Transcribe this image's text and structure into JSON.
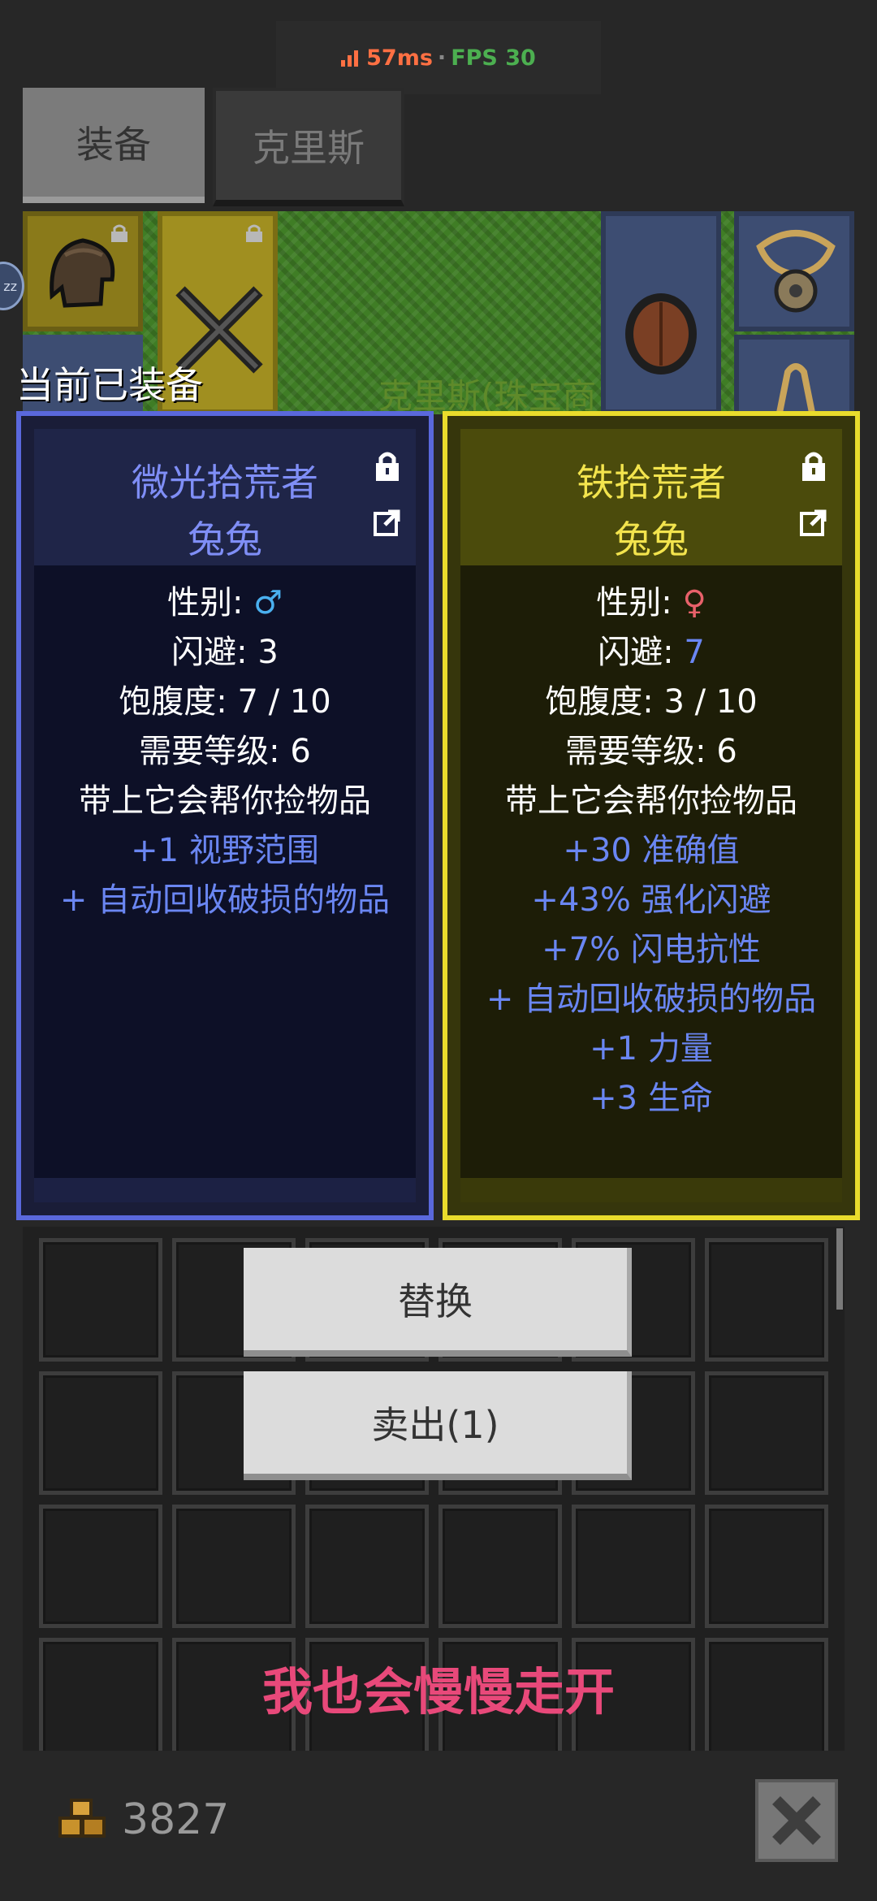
{
  "status": {
    "ping": "57ms",
    "separator": "·",
    "fps": "FPS 30"
  },
  "tabs": [
    {
      "label": "装备",
      "active": true
    },
    {
      "label": "克里斯",
      "active": false
    }
  ],
  "scene": {
    "npc_name": "克里斯(珠宝商",
    "sleep_text": "zz"
  },
  "current_equipped_label": "当前已装备",
  "cards": {
    "left": {
      "name": "微光拾荒者",
      "pet": "兔兔",
      "gender_label": "性别: ",
      "gender_symbol": "♂",
      "dodge_label": "闪避: ",
      "dodge_value": "3",
      "satiety": "饱腹度: 7 / 10",
      "level": "需要等级: 6",
      "desc": "带上它会帮你捡物品",
      "bonuses": [
        "+1 视野范围",
        "+ 自动回收破损的物品"
      ],
      "frame_color": "#5a68dc"
    },
    "right": {
      "name": "铁拾荒者",
      "pet": "兔兔",
      "gender_label": "性别: ",
      "gender_symbol": "♀",
      "dodge_label": "闪避: ",
      "dodge_value": "7",
      "satiety": "饱腹度: 3 / 10",
      "level": "需要等级: 6",
      "desc": "带上它会帮你捡物品",
      "bonuses": [
        "+30 准确值",
        "+43% 强化闪避",
        "+7% 闪电抗性",
        "+ 自动回收破损的物品",
        "+1 力量",
        "+3 生命"
      ],
      "frame_color": "#e9dc2c"
    }
  },
  "actions": {
    "replace": "替换",
    "sell": "卖出(1)"
  },
  "float_message": "我也会慢慢走开",
  "footer": {
    "gold": "3827"
  },
  "icons": [
    "lock-icon",
    "share-icon",
    "coin-icon",
    "close-icon",
    "signal-icon",
    "helmet-icon",
    "sword-icon",
    "shield-icon",
    "necklace-icon",
    "ring-icon"
  ]
}
